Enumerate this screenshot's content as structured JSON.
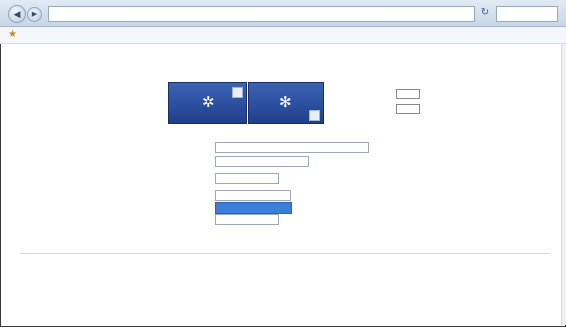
{
  "browser": {
    "nav_back_glyph": "◀",
    "nav_forward_glyph": "▶",
    "address_text": "",
    "refresh_glyph": "↻",
    "favorites_glyph": "★",
    "favorites_label": ""
  },
  "page": {
    "title": "",
    "tile_a_glyph": "✲",
    "tile_b_glyph": "✻",
    "side_buttons": [
      "",
      ""
    ],
    "rows": [
      {
        "label": "",
        "value": ""
      },
      {
        "label": "",
        "value": ""
      },
      {
        "label": "",
        "value": ""
      },
      {
        "label": "",
        "value": ""
      },
      {
        "label": "",
        "value": ""
      }
    ],
    "suggestion": "",
    "right_link": "",
    "bottom_links": [
      "",
      ""
    ],
    "footer_text": ""
  },
  "colors": {
    "tile": "#2a4d9e",
    "link": "#2256a8",
    "suggestion_highlight": "#3d7fd8"
  }
}
